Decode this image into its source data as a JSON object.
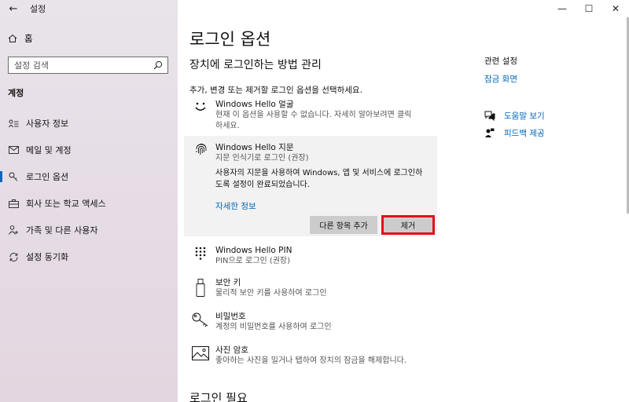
{
  "window": {
    "app_title": "설정",
    "back_glyph": "←",
    "minimize_glyph": "—",
    "maximize_glyph": "☐",
    "close_glyph": "✕"
  },
  "sidebar": {
    "home_label": "홈",
    "search_placeholder": "설정 검색",
    "section_title": "계정",
    "active_item": "로그인 옵션",
    "items": [
      {
        "label": "사용자 정보",
        "icon": "user-info-icon"
      },
      {
        "label": "메일 및 계정",
        "icon": "mail-icon"
      },
      {
        "label": "로그인 옵션",
        "icon": "key-icon"
      },
      {
        "label": "회사 또는 학교 액세스",
        "icon": "briefcase-icon"
      },
      {
        "label": "가족 및 다른 사용자",
        "icon": "family-icon"
      },
      {
        "label": "설정 동기화",
        "icon": "sync-icon"
      }
    ]
  },
  "main": {
    "page_title": "로그인 옵션",
    "subheading": "장치에 로그인하는 방법 관리",
    "instruction": "추가, 변경 또는 제거할 로그인 옵션을 선택하세요.",
    "face": {
      "title": "Windows Hello 얼굴",
      "desc_line1": "현재 이 옵션을 사용할 수 없습니다. 자세히 알아보려면 클릭",
      "desc_line2": "하세요."
    },
    "fingerprint": {
      "title": "Windows Hello 지문",
      "subtitle": "지문 인식기로 로그인 (권장)",
      "body_line1": "사용자의 지문을 사용하여 Windows, 앱 및 서비스에 로그인하",
      "body_line2": "도록 설정이 완료되었습니다.",
      "link": "자세한 정보",
      "add_button": "다른 항목 추가",
      "remove_button": "제거"
    },
    "pin": {
      "title": "Windows Hello PIN",
      "desc": "PIN으로 로그인 (권장)"
    },
    "security_key": {
      "title": "보안 키",
      "desc": "물리적 보안 키를 사용하여 로그인"
    },
    "password": {
      "title": "비밀번호",
      "desc": "계정의 비밀번호를 사용하여 로그인"
    },
    "picture_password": {
      "title": "사진 암호",
      "desc": "좋아하는 사진을 밀거나 탭하여 장치의 잠금을 해제합니다."
    },
    "sign_in_required": "로그인 필요"
  },
  "related": {
    "title": "관련 설정",
    "lock_screen": "잠금 화면",
    "help": "도움말 보기",
    "feedback": "피드백 제공"
  },
  "colors": {
    "accent": "#0067b8",
    "highlight_border": "#e0101e",
    "sidebar_bg": "#e6dde6"
  }
}
